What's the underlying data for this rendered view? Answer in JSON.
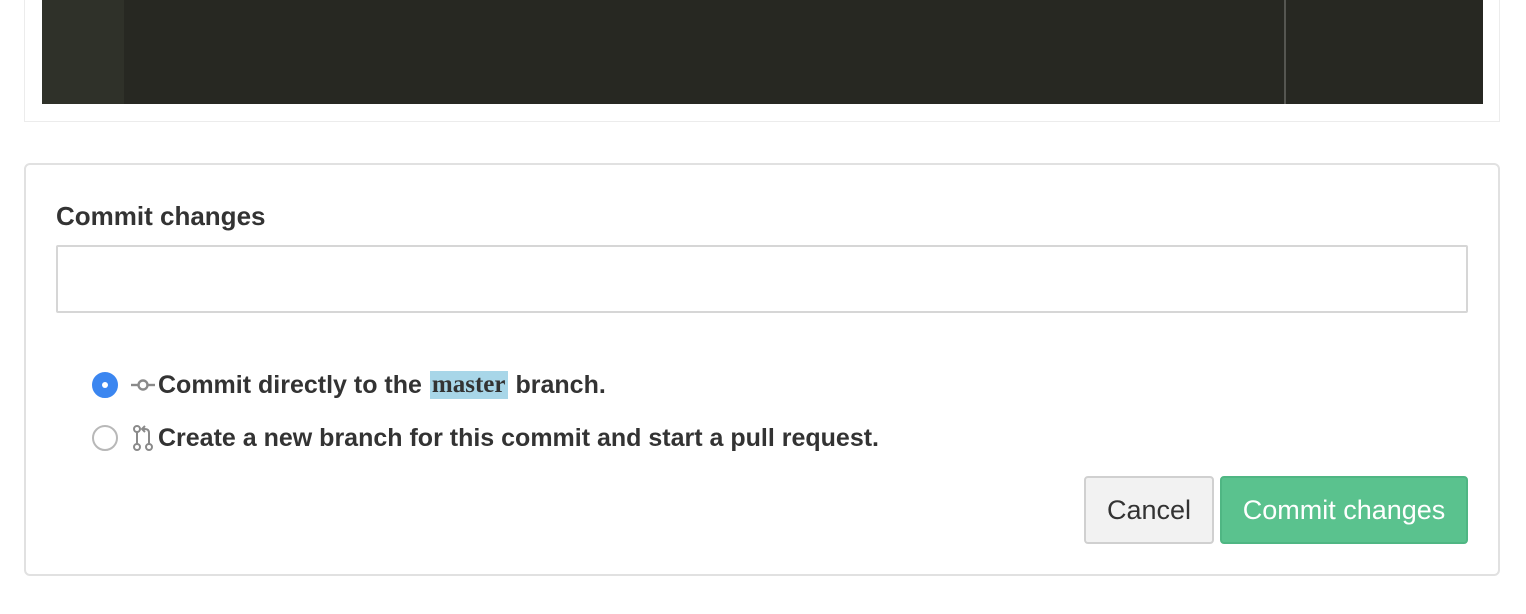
{
  "commit_form": {
    "title": "Commit changes",
    "message_value": "",
    "message_placeholder": "",
    "options": [
      {
        "selected": true,
        "label_prefix": "Commit directly to the",
        "branch": "master",
        "label_suffix": "branch.",
        "icon": "git-commit-icon"
      },
      {
        "selected": false,
        "label": "Create a new branch for this commit and start a pull request.",
        "icon": "git-pull-request-icon"
      }
    ],
    "cancel_label": "Cancel",
    "submit_label": "Commit changes"
  },
  "colors": {
    "editor_background": "#272822",
    "radio_selected": "#3b86f0",
    "branch_highlight": "#a8d6e8",
    "submit_button": "#5ac28e"
  }
}
